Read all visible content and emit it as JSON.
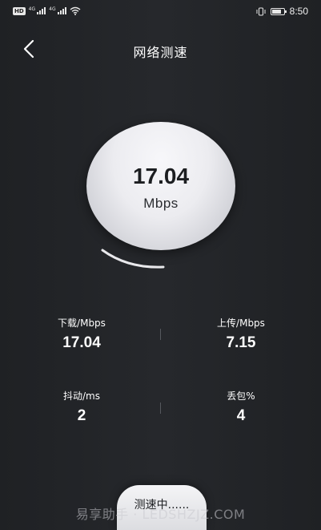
{
  "status_bar": {
    "hd_badge": "HD",
    "network_1": "4G",
    "network_2": "4G",
    "time": "8:50",
    "icons": [
      "hd-icon",
      "signal-icon",
      "signal-icon",
      "wifi-icon",
      "vibrate-icon",
      "battery-icon"
    ],
    "battery_level": 0.8
  },
  "header": {
    "title": "网络测速",
    "back_icon": "chevron-left-icon"
  },
  "gauge": {
    "value": "17.04",
    "unit": "Mbps"
  },
  "stats": {
    "download": {
      "label": "下载/Mbps",
      "value": "17.04"
    },
    "upload": {
      "label": "上传/Mbps",
      "value": "7.15"
    },
    "jitter": {
      "label": "抖动/ms",
      "value": "2"
    },
    "packet_loss": {
      "label": "丢包%",
      "value": "4"
    }
  },
  "bottom": {
    "button_label": "测速中......",
    "watermark": "易享助手 · LEDSHZJZ.COM"
  },
  "colors": {
    "background": "#232528",
    "gauge": "#ececf0",
    "text": "#ffffff",
    "button": "#f4f4f6"
  }
}
